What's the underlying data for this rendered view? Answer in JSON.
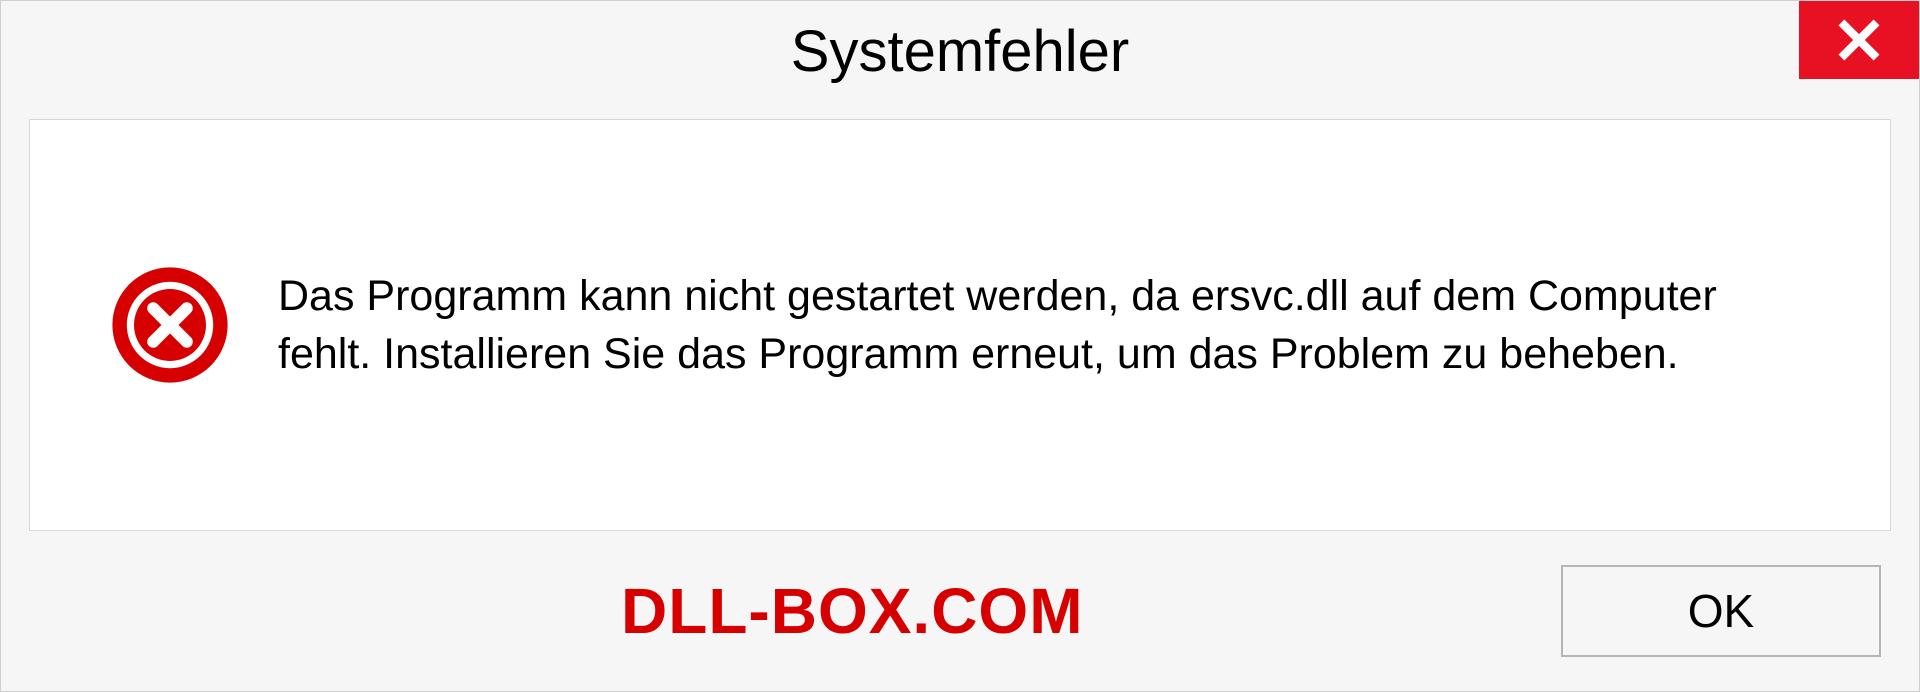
{
  "dialog": {
    "title": "Systemfehler",
    "message": "Das Programm kann nicht gestartet werden, da ersvc.dll auf dem Computer fehlt. Installieren Sie das Programm erneut, um das Problem zu beheben.",
    "ok_label": "OK"
  },
  "watermark": "DLL-BOX.COM",
  "colors": {
    "close_bg": "#e81123",
    "error_red": "#d60000"
  }
}
